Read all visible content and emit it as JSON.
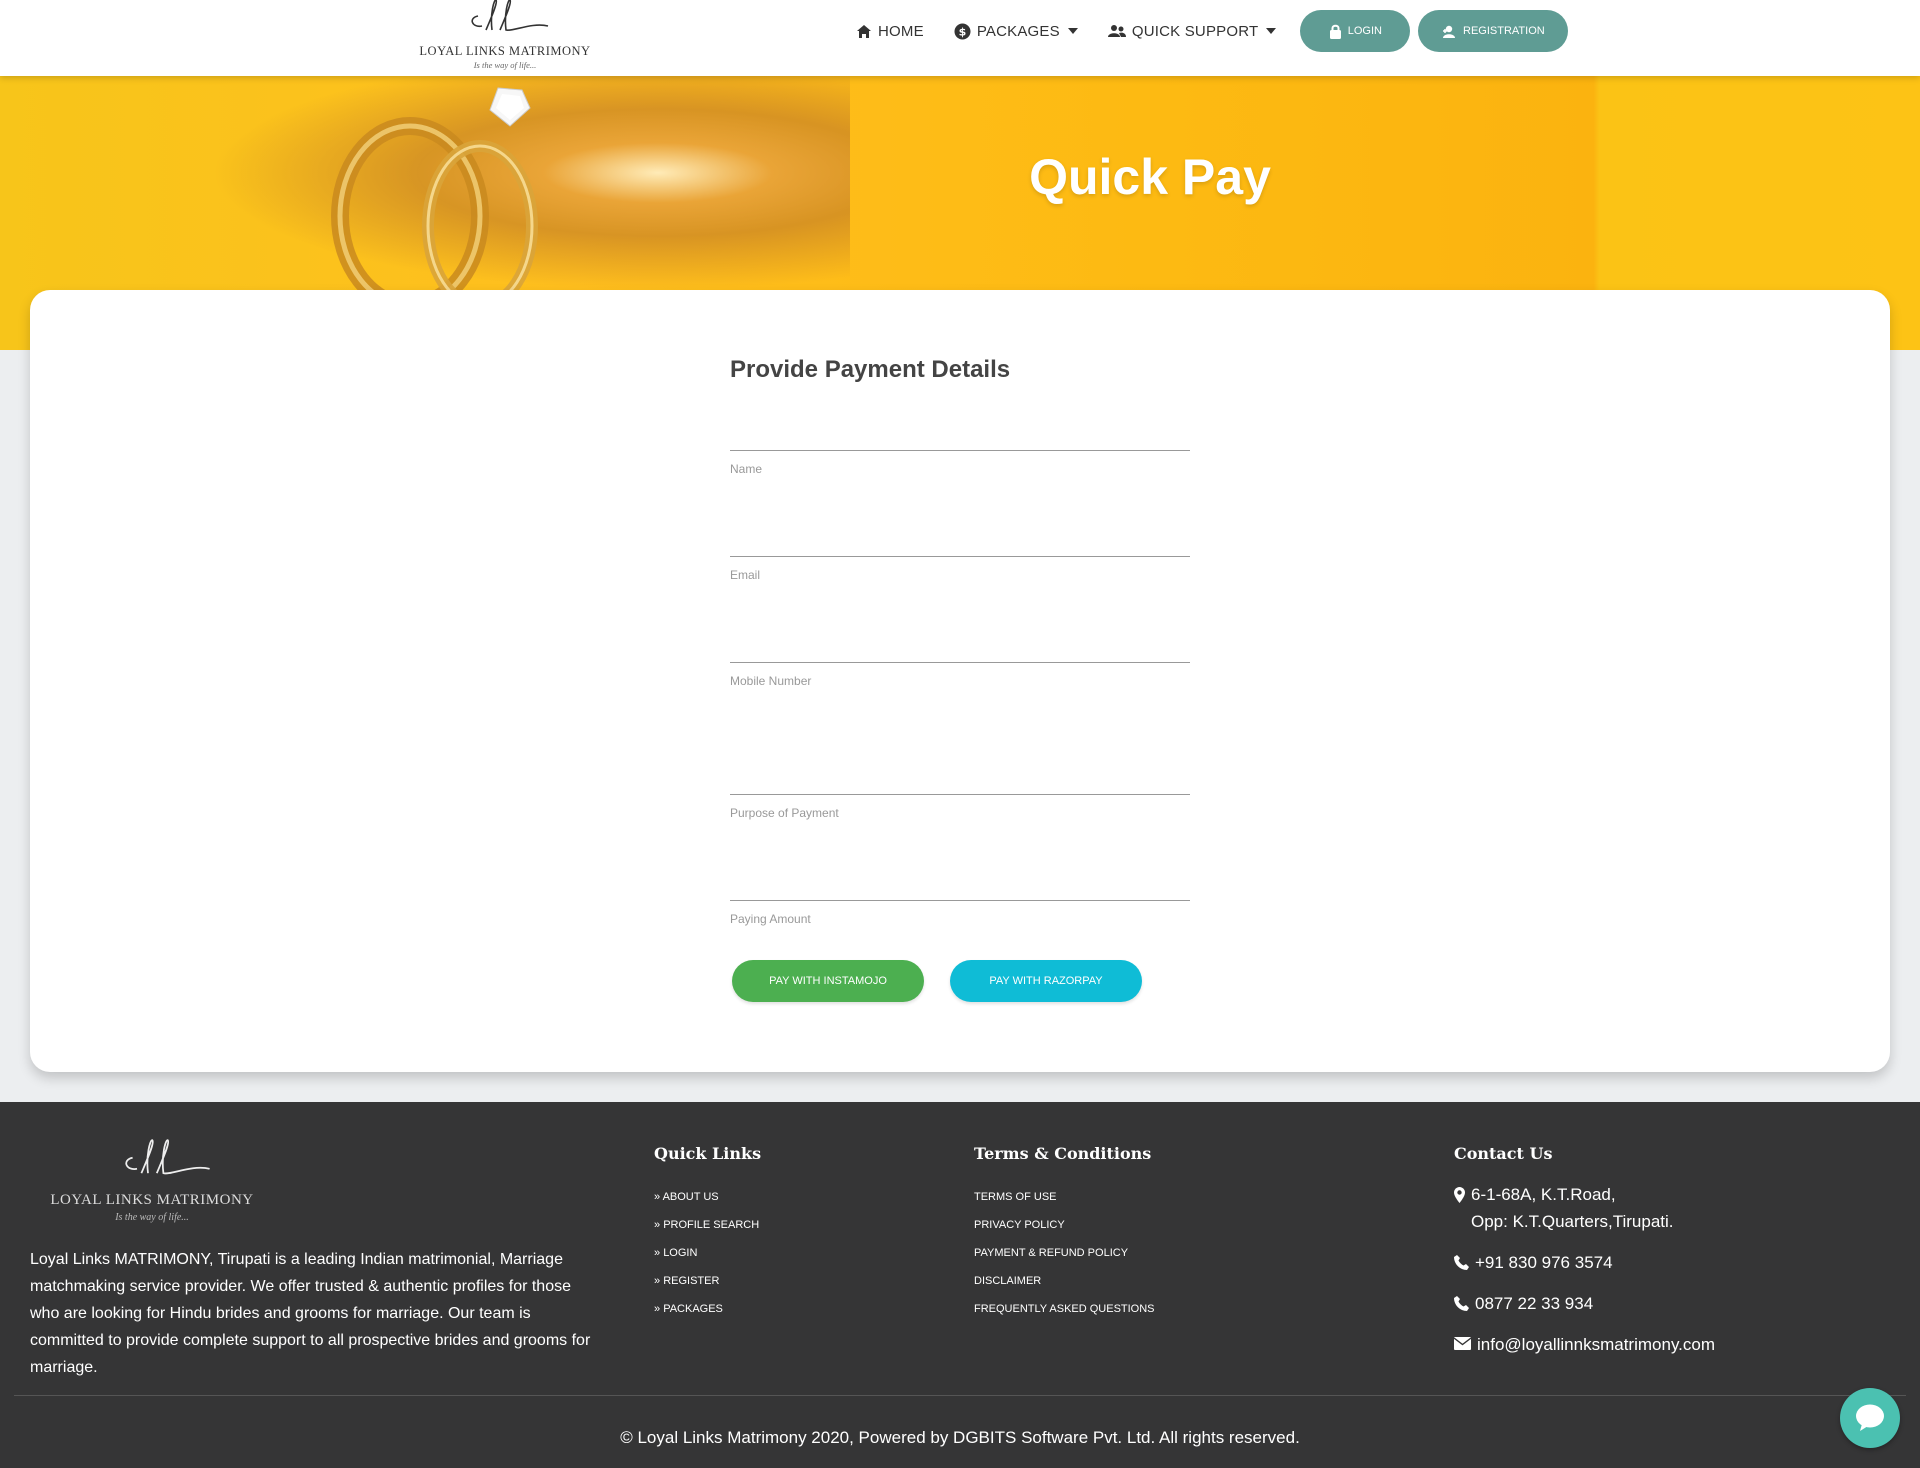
{
  "brand": {
    "name": "LOYAL LINKS MATRIMONY",
    "tagline": "Is the way of life..."
  },
  "nav": {
    "home": "HOME",
    "packages": "PACKAGES",
    "quick_support": "QUICK SUPPORT",
    "login": "LOGIN",
    "registration": "REGISTRATION"
  },
  "banner": {
    "title": "Quick Pay"
  },
  "form": {
    "title": "Provide Payment Details",
    "fields": [
      {
        "label": "Name",
        "value": ""
      },
      {
        "label": "Email",
        "value": ""
      },
      {
        "label": "Mobile Number",
        "value": ""
      },
      {
        "label": "Purpose of Payment",
        "value": ""
      },
      {
        "label": "Paying Amount",
        "value": ""
      }
    ],
    "buttons": {
      "instamojo": "PAY WITH INSTAMOJO",
      "razorpay": "PAY WITH RAZORPAY"
    }
  },
  "footer": {
    "about": "Loyal Links MATRIMONY, Tirupati is a leading Indian matrimonial, Marriage matchmaking service provider. We offer trusted & authentic profiles for those who are looking for Hindu brides and grooms for marriage. Our team is committed to provide complete support to all prospective brides and grooms for marriage.",
    "quick_links": {
      "title": "Quick Links",
      "items": [
        "ABOUT US",
        "PROFILE SEARCH",
        "LOGIN",
        "REGISTER",
        "PACKAGES"
      ]
    },
    "terms": {
      "title": "Terms & Conditions",
      "items": [
        "TERMS OF USE",
        "PRIVACY POLICY",
        "PAYMENT & REFUND POLICY",
        "DISCLAIMER",
        "FREQUENTLY ASKED QUESTIONS"
      ]
    },
    "contact": {
      "title": "Contact Us",
      "address_line1": "6-1-68A, K.T.Road,",
      "address_line2": "Opp: K.T.Quarters,Tirupati.",
      "phone1": "+91 830 976 3574",
      "phone2": "0877 22 33 934",
      "email": "info@loyallinnksmatrimony.com"
    },
    "copyright": "© Loyal Links Matrimony 2020, Powered by DGBITS Software Pvt. Ltd. All rights reserved."
  },
  "colors": {
    "accent_teal": "#5f9c94",
    "instamojo_green": "#4caf50",
    "razorpay_cyan": "#0fbcd6",
    "banner_yellow": "#fdba12",
    "footer_bg": "#353536"
  }
}
